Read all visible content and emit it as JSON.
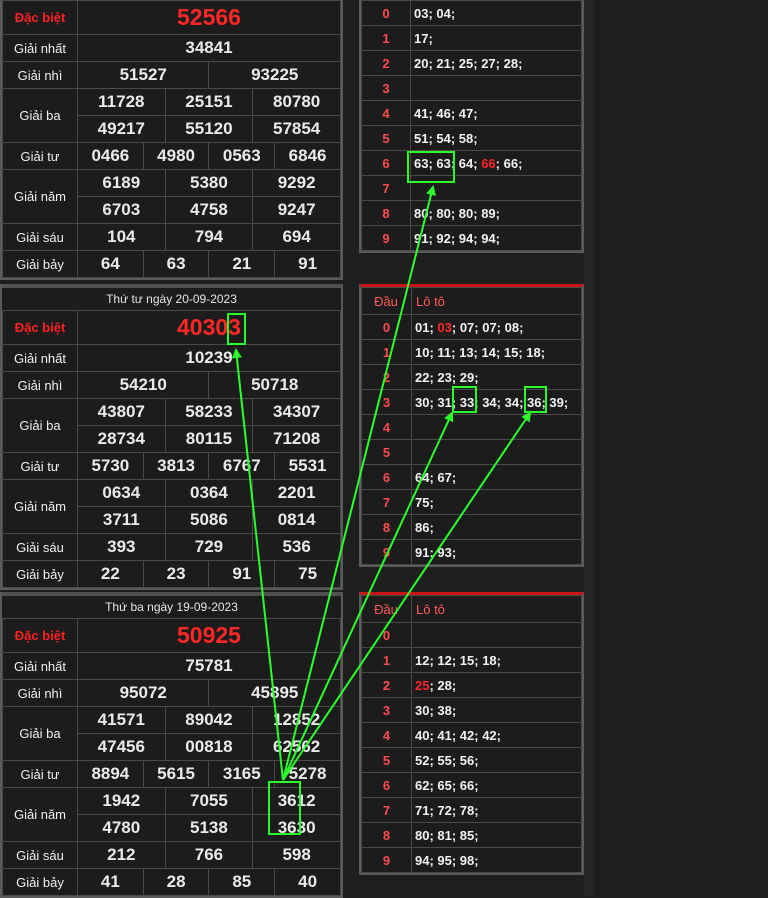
{
  "label_titles": {
    "special": "Đặc biệt",
    "first": "Giải nhất",
    "second": "Giải nhì",
    "third": "Giải ba",
    "fourth": "Giải tư",
    "fifth": "Giải năm",
    "sixth": "Giải sáu",
    "seventh": "Giải bảy"
  },
  "loto_header": {
    "head": "Đầu",
    "loto": "Lô tô"
  },
  "draws": [
    {
      "date": "",
      "special": "52566",
      "first": "34841",
      "second": [
        "51527",
        "93225"
      ],
      "third": [
        "11728",
        "25151",
        "80780",
        "49217",
        "55120",
        "57854"
      ],
      "fourth": [
        "0466",
        "4980",
        "0563",
        "6846"
      ],
      "fifth": [
        "6189",
        "5380",
        "9292",
        "6703",
        "4758",
        "9247"
      ],
      "sixth": [
        "104",
        "794",
        "694"
      ],
      "seventh": [
        "64",
        "63",
        "21",
        "91"
      ]
    },
    {
      "date": "Thứ tư ngày 20-09-2023",
      "special": "40303",
      "first": "10239",
      "second": [
        "54210",
        "50718"
      ],
      "third": [
        "43807",
        "58233",
        "34307",
        "28734",
        "80115",
        "71208"
      ],
      "fourth": [
        "5730",
        "3813",
        "6767",
        "5531"
      ],
      "fifth": [
        "0634",
        "0364",
        "2201",
        "3711",
        "5086",
        "0814"
      ],
      "sixth": [
        "393",
        "729",
        "536"
      ],
      "seventh": [
        "22",
        "23",
        "91",
        "75"
      ]
    },
    {
      "date": "Thứ ba ngày 19-09-2023",
      "special": "50925",
      "first": "75781",
      "second": [
        "95072",
        "45895"
      ],
      "third": [
        "41571",
        "89042",
        "12852",
        "47456",
        "00818",
        "62562"
      ],
      "fourth": [
        "8894",
        "5615",
        "3165",
        "5278"
      ],
      "fifth": [
        "1942",
        "7055",
        "3612",
        "4780",
        "5138",
        "3630"
      ],
      "sixth": [
        "212",
        "766",
        "598"
      ],
      "seventh": [
        "41",
        "28",
        "85",
        "40"
      ]
    }
  ],
  "loto_tables": [
    {
      "rows": [
        {
          "head": "0",
          "parts": [
            {
              "t": "03; 04;"
            }
          ]
        },
        {
          "head": "1",
          "parts": [
            {
              "t": "17;"
            }
          ]
        },
        {
          "head": "2",
          "parts": [
            {
              "t": "20; 21; 25; 27; 28;"
            }
          ]
        },
        {
          "head": "3",
          "parts": []
        },
        {
          "head": "4",
          "parts": [
            {
              "t": "41; 46; 47;"
            }
          ]
        },
        {
          "head": "5",
          "parts": [
            {
              "t": "51; 54; 58;"
            }
          ]
        },
        {
          "head": "6",
          "parts": [
            {
              "t": "63; 63; 64; "
            },
            {
              "t": "66",
              "red": true
            },
            {
              "t": "; 66;"
            }
          ]
        },
        {
          "head": "7",
          "parts": []
        },
        {
          "head": "8",
          "parts": [
            {
              "t": "80; 80; 80; 89;"
            }
          ]
        },
        {
          "head": "9",
          "parts": [
            {
              "t": "91; 92; 94; 94;"
            }
          ]
        }
      ]
    },
    {
      "rows": [
        {
          "head": "0",
          "parts": [
            {
              "t": "01; "
            },
            {
              "t": "03",
              "red": true
            },
            {
              "t": "; 07; 07; 08;"
            }
          ]
        },
        {
          "head": "1",
          "parts": [
            {
              "t": "10; 11; 13; 14; 15; 18;"
            }
          ]
        },
        {
          "head": "2",
          "parts": [
            {
              "t": "22; 23; 29;"
            }
          ]
        },
        {
          "head": "3",
          "parts": [
            {
              "t": "30; 31; 33; 34; 34; 36; 39;"
            }
          ]
        },
        {
          "head": "4",
          "parts": []
        },
        {
          "head": "5",
          "parts": []
        },
        {
          "head": "6",
          "parts": [
            {
              "t": "64; 67;"
            }
          ]
        },
        {
          "head": "7",
          "parts": [
            {
              "t": "75;"
            }
          ]
        },
        {
          "head": "8",
          "parts": [
            {
              "t": "86;"
            }
          ]
        },
        {
          "head": "9",
          "parts": [
            {
              "t": "91; 93;"
            }
          ]
        }
      ]
    },
    {
      "rows": [
        {
          "head": "0",
          "parts": []
        },
        {
          "head": "1",
          "parts": [
            {
              "t": "12; 12; 15; 18;"
            }
          ]
        },
        {
          "head": "2",
          "parts": [
            {
              "t": "25",
              "red": true
            },
            {
              "t": "; 28;"
            }
          ]
        },
        {
          "head": "3",
          "parts": [
            {
              "t": "30; 38;"
            }
          ]
        },
        {
          "head": "4",
          "parts": [
            {
              "t": "40; 41; 42; 42;"
            }
          ]
        },
        {
          "head": "5",
          "parts": [
            {
              "t": "52; 55; 56;"
            }
          ]
        },
        {
          "head": "6",
          "parts": [
            {
              "t": "62; 65; 66;"
            }
          ]
        },
        {
          "head": "7",
          "parts": [
            {
              "t": "71; 72; 78;"
            }
          ]
        },
        {
          "head": "8",
          "parts": [
            {
              "t": "80; 81; 85;"
            }
          ]
        },
        {
          "head": "9",
          "parts": [
            {
              "t": "94; 95; 98;"
            }
          ]
        }
      ]
    }
  ],
  "colors": {
    "highlight": "#2bff2b",
    "special": "#ff2626",
    "accent": "#c91515"
  }
}
